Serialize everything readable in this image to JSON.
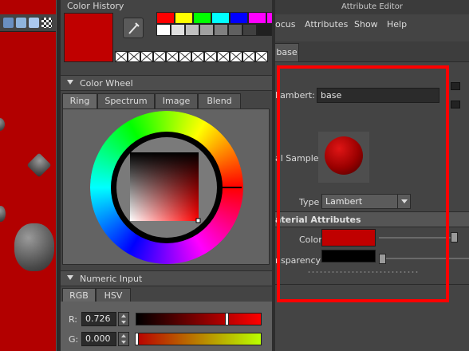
{
  "color_chooser": {
    "history_label": "Color History",
    "current_color": "#c00000",
    "palette_row1": [
      "#ff0000",
      "#ffff00",
      "#00ff00",
      "#00ffff",
      "#0000ff",
      "#ff00ff",
      "#ff00ff"
    ],
    "palette_row2": [
      "#ffffff",
      "#e0e0e0",
      "#c0c0c0",
      "#a0a0a0",
      "#808080",
      "#606060",
      "#404040",
      "#202020",
      "#000000"
    ],
    "wheel_section": "Color Wheel",
    "wheel_tabs": [
      "Ring",
      "Spectrum",
      "Image",
      "Blend"
    ],
    "numeric_section": "Numeric Input",
    "numeric_tabs": [
      "RGB",
      "HSV"
    ],
    "r_label": "R:",
    "r_value": "0.726",
    "g_label": "G:",
    "g_value": "0.000"
  },
  "attribute_editor": {
    "window_title": "Attribute Editor",
    "menus": [
      "ocus",
      "Attributes",
      "Show",
      "Help"
    ],
    "node_tab": "base",
    "lambert_label": "Lambert:",
    "node_name": "base",
    "sample_label": "al Sample",
    "type_label": "Type",
    "type_value": "Lambert",
    "section_header": "aterial Attributes",
    "color_label": "Color",
    "color_value": "#c00000",
    "color_level": 0.95,
    "transparency_label": "nsparency",
    "transparency_value": "#000000",
    "transparency_level": 0.0
  },
  "colors": {
    "highlight": "#ff0000",
    "viewport_bg": "#b20000"
  }
}
